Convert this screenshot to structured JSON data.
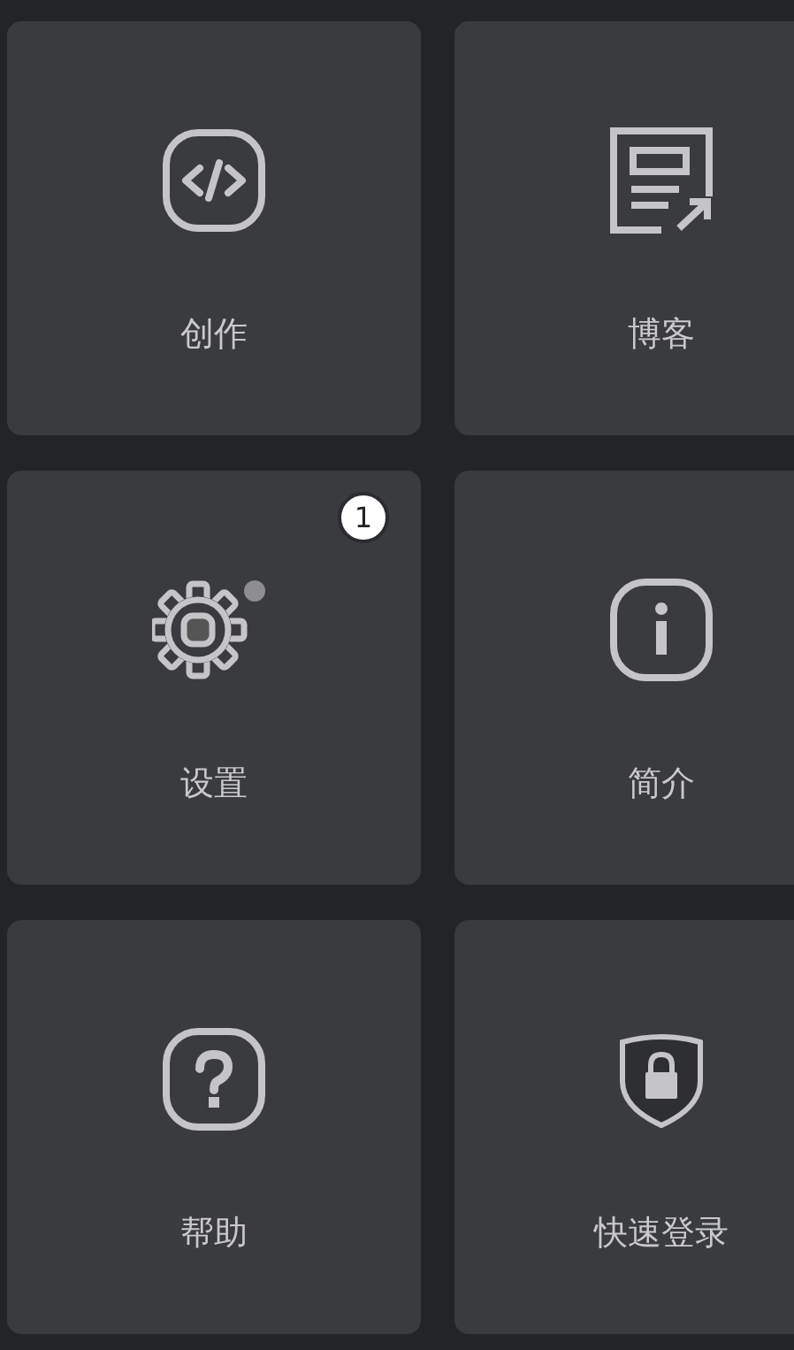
{
  "tiles": [
    {
      "kind": "code",
      "label": "创作"
    },
    {
      "kind": "blog",
      "label": "博客"
    },
    {
      "kind": "settings",
      "label": "设置",
      "badge": "1"
    },
    {
      "kind": "info",
      "label": "简介"
    },
    {
      "kind": "help",
      "label": "帮助"
    },
    {
      "kind": "login",
      "label": "快速登录"
    }
  ]
}
